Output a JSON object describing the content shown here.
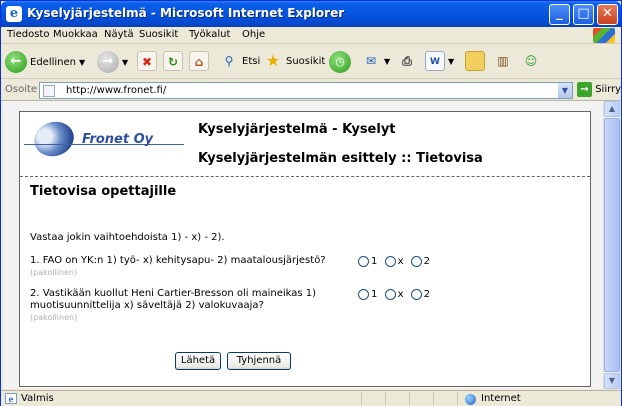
{
  "window": {
    "title": "Kyselyjärjestelmä - Microsoft Internet Explorer",
    "controls": {
      "minimize": "_",
      "maximize": "□",
      "close": "✕"
    }
  },
  "menu": [
    "Tiedosto",
    "Muokkaa",
    "Näytä",
    "Suosikit",
    "Työkalut",
    "Ohje"
  ],
  "toolbar": {
    "back_label": "Edellinen",
    "search_label": "Etsi",
    "favorites_label": "Suosikit"
  },
  "address": {
    "label": "Osoite",
    "url": "http://www.fronet.fi/",
    "go_label": "Siirry"
  },
  "page": {
    "logo_text": "Fronet Oy",
    "header_line1": "Kyselyjärjestelmä - Kyselyt",
    "header_line2": "Kyselyjärjestelmän esittely :: Tietovisa",
    "quiz_title": "Tietovisa opettajille",
    "intro": "Vastaa jokin vaihtoehdoista 1) - x) - 2).",
    "questions": [
      {
        "text": "1. FAO on YK:n 1) työ- x) kehitysapu- 2) maatalousjärjestö?",
        "required": "(pakollinen)",
        "options": [
          "1",
          "x",
          "2"
        ]
      },
      {
        "text": "2. Vastikään kuollut Heni Cartier-Bresson oli maineikas 1) muotisuunnittelija x) säveltäjä 2) valokuvaaja?",
        "required": "(pakollinen)",
        "options": [
          "1",
          "x",
          "2"
        ]
      }
    ],
    "submit_label": "Lähetä",
    "reset_label": "Tyhjennä"
  },
  "status": {
    "text": "Valmis",
    "zone": "Internet"
  },
  "colors": {
    "titlebar": "#0654DF",
    "logo_blue": "#2F4FA0",
    "required_grey": "#B0B0B0"
  }
}
